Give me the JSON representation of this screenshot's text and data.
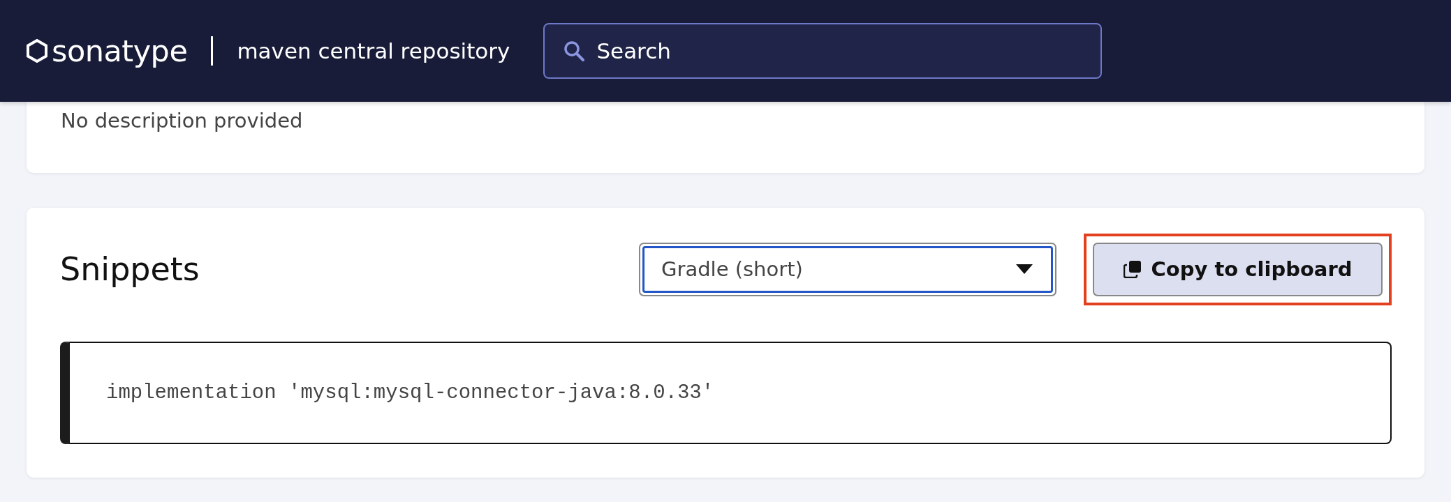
{
  "header": {
    "logo_text": "sonatype",
    "subtitle": "maven central repository",
    "search": {
      "placeholder": "Search"
    }
  },
  "description_card": {
    "text": "No description provided"
  },
  "snippets": {
    "title": "Snippets",
    "format_select": {
      "value": "Gradle (short)",
      "focused": true
    },
    "copy_button": {
      "label": "Copy to clipboard",
      "highlighted": true
    },
    "code": "implementation 'mysql:mysql-connector-java:8.0.33'"
  }
}
